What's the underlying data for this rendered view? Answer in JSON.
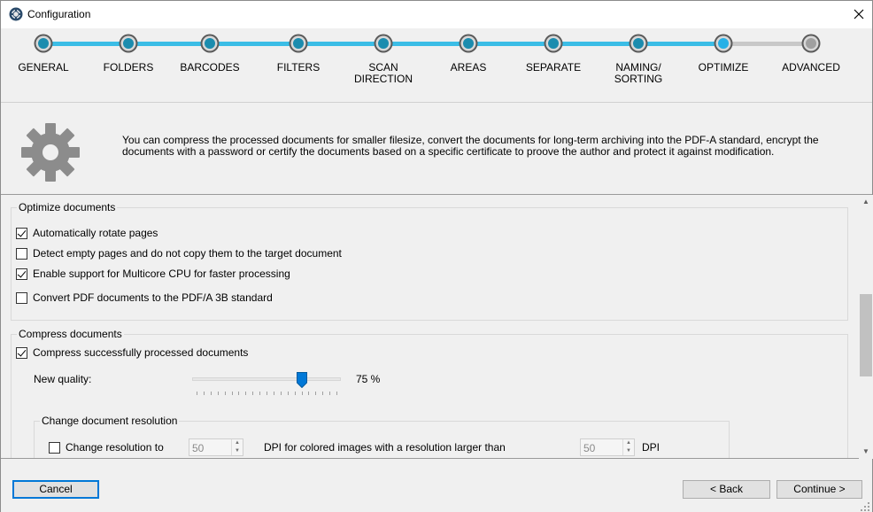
{
  "window": {
    "title": "Configuration",
    "close_icon": "close-icon"
  },
  "wizard": {
    "steps": [
      {
        "label": "GENERAL",
        "state": "done"
      },
      {
        "label": "FOLDERS",
        "state": "done"
      },
      {
        "label": "BARCODES",
        "state": "done"
      },
      {
        "label": "FILTERS",
        "state": "done"
      },
      {
        "label": "SCAN\nDIRECTION",
        "state": "done"
      },
      {
        "label": "AREAS",
        "state": "done"
      },
      {
        "label": "SEPARATE",
        "state": "done"
      },
      {
        "label": "NAMING/\nSORTING",
        "state": "done"
      },
      {
        "label": "OPTIMIZE",
        "state": "current"
      },
      {
        "label": "ADVANCED",
        "state": "pending"
      }
    ],
    "colors": {
      "done": "#1b8cae",
      "current": "#26b0e6",
      "pending": "#a0a0a0",
      "line_done": "#3bbde6",
      "line_pending": "#c8c8c8"
    }
  },
  "info": {
    "icon": "gear-icon",
    "text": "You can compress the processed documents for smaller filesize, convert the documents for long-term archiving into the PDF-A standard, encrypt the documents with a password or certify the documents based on a specific certificate to proove the author and protect it against modification."
  },
  "optimize": {
    "legend": "Optimize documents",
    "options": [
      {
        "label": "Automatically rotate pages",
        "checked": true
      },
      {
        "label": "Detect empty pages and do not copy them to the target document",
        "checked": false
      },
      {
        "label": "Enable support for Multicore CPU for faster processing",
        "checked": true
      },
      {
        "label": "Convert PDF documents to the PDF/A 3B standard",
        "checked": false
      }
    ]
  },
  "compress": {
    "legend": "Compress documents",
    "enable_label": "Compress successfully processed documents",
    "enable_checked": true,
    "quality_label": "New quality:",
    "quality_value": 75,
    "quality_text": "75 %",
    "resolution": {
      "legend": "Change document resolution",
      "change_label": "Change resolution to",
      "change_checked": false,
      "dpi_value": "50",
      "middle_text": "DPI for colored images with a resolution larger than",
      "threshold_value": "50",
      "unit_text": "DPI"
    }
  },
  "footer": {
    "cancel_label": "Cancel",
    "back_label": "< Back",
    "continue_label": "Continue >"
  }
}
